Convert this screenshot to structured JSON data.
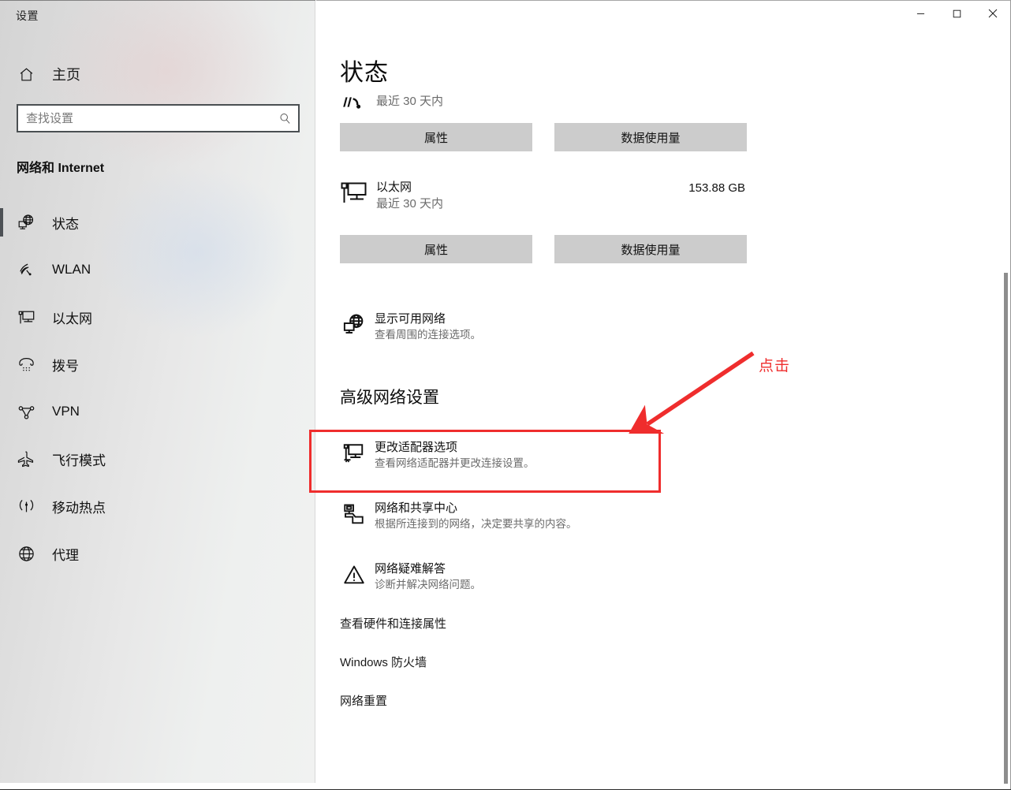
{
  "window": {
    "title": "设置",
    "titlebar": {
      "minimize_label": "最小化",
      "maximize_label": "最大化",
      "close_label": "关闭"
    }
  },
  "sidebar": {
    "home_label": "主页",
    "home_icon": "home-icon",
    "search": {
      "placeholder": "查找设置",
      "value": "",
      "icon": "search-icon"
    },
    "category_title": "网络和 Internet",
    "items": [
      {
        "label": "状态",
        "icon": "globe-monitor-icon",
        "selected": true
      },
      {
        "label": "WLAN",
        "icon": "wifi-icon",
        "selected": false
      },
      {
        "label": "以太网",
        "icon": "ethernet-icon",
        "selected": false
      },
      {
        "label": "拨号",
        "icon": "phone-dial-icon",
        "selected": false
      },
      {
        "label": "VPN",
        "icon": "vpn-icon",
        "selected": false
      },
      {
        "label": "飞行模式",
        "icon": "airplane-icon",
        "selected": false
      },
      {
        "label": "移动热点",
        "icon": "hotspot-icon",
        "selected": false
      },
      {
        "label": "代理",
        "icon": "globe-icon",
        "selected": false
      }
    ]
  },
  "main": {
    "heading": "状态",
    "networks": [
      {
        "icon": "wifi-signal-icon",
        "name": "",
        "subtitle": "最近 30 天内",
        "usage": "",
        "buttons": {
          "properties": "属性",
          "data_usage": "数据使用量"
        }
      },
      {
        "icon": "ethernet-monitor-icon",
        "name": "以太网",
        "subtitle": "最近 30 天内",
        "usage": "153.88 GB",
        "buttons": {
          "properties": "属性",
          "data_usage": "数据使用量"
        }
      }
    ],
    "show_available": {
      "icon": "globe-monitor-icon",
      "title": "显示可用网络",
      "desc": "查看周围的连接选项。"
    },
    "advanced_heading": "高级网络设置",
    "advanced_entries": [
      {
        "icon": "adapter-monitor-icon",
        "title": "更改适配器选项",
        "desc": "查看网络适配器并更改连接设置。",
        "highlighted": true
      },
      {
        "icon": "share-center-icon",
        "title": "网络和共享中心",
        "desc": "根据所连接到的网络，决定要共享的内容。",
        "highlighted": false
      },
      {
        "icon": "warning-triangle-icon",
        "title": "网络疑难解答",
        "desc": "诊断并解决网络问题。",
        "highlighted": false
      }
    ],
    "links": [
      {
        "label": "查看硬件和连接属性"
      },
      {
        "label": "Windows 防火墙"
      },
      {
        "label": "网络重置"
      }
    ]
  },
  "annotation": {
    "click_label": "点击",
    "color": "#ef2d2d",
    "arrow_icon": "arrow-pointing-down-left-icon",
    "box_target": "更改适配器选项"
  },
  "scrollbar": {
    "orientation": "vertical",
    "name": "content-scrollbar"
  }
}
